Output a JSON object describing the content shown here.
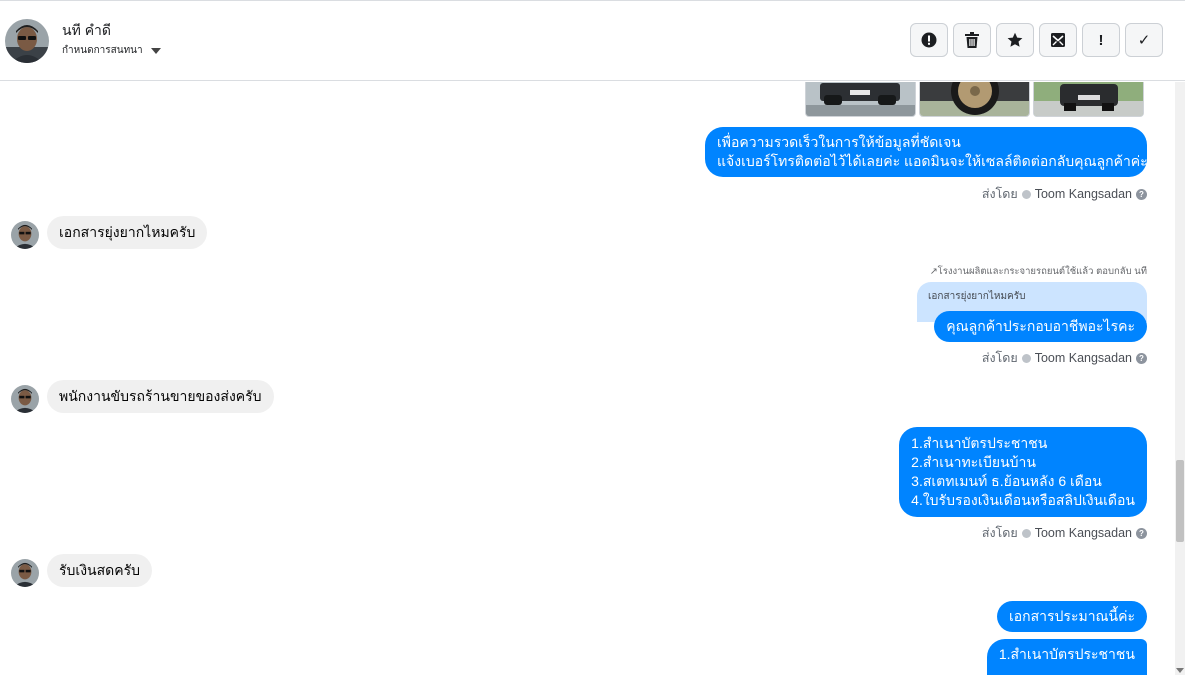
{
  "header": {
    "contact_name": "นที คำดี",
    "assign_label": "กำหนดการสนทนา",
    "toolbar": [
      {
        "name": "spam-button",
        "icon": "alert-circle-icon"
      },
      {
        "name": "delete-button",
        "icon": "trash-icon"
      },
      {
        "name": "star-button",
        "icon": "star-icon"
      },
      {
        "name": "mark-unread-button",
        "icon": "envelope-icon"
      },
      {
        "name": "follow-up-button",
        "icon": "exclamation-icon",
        "glyph": "!"
      },
      {
        "name": "done-button",
        "icon": "check-icon",
        "glyph": "✓"
      }
    ]
  },
  "messages": {
    "m1_out": {
      "lines": [
        "เพื่อความรวดเร็วในการให้ข้อมูลที่ชัดเจน",
        "แจ้งเบอร์โทรติดต่อไว้ได้เลยค่ะ แอดมินจะให้เซลล์ติดต่อกลับคุณลูกค้าค่ะ"
      ],
      "sent_by_label": "ส่งโดย",
      "sender": "Toom Kangsadan"
    },
    "m2_in": {
      "text": "เอกสารยุ่งยากไหมครับ"
    },
    "m3_out": {
      "reply_note": "โรงงานผลิตและกระจายรถยนต์ใช้แล้ว ตอบกลับ นที",
      "quote": "เอกสารยุ่งยากไหมครับ",
      "text": "คุณลูกค้าประกอบอาชีพอะไรคะ",
      "sent_by_label": "ส่งโดย",
      "sender": "Toom Kangsadan"
    },
    "m4_in": {
      "text": "พนักงานขับรถร้านขายของส่งครับ"
    },
    "m5_out": {
      "lines": [
        "1.สำเนาบัตรประชาชน",
        "2.สำเนาทะเบียนบ้าน",
        "3.สเตทเมนท์ ธ.ย้อนหลัง 6 เดือน",
        "4.ใบรับรองเงินเดือนหรือสลิปเงินเดือน"
      ],
      "sent_by_label": "ส่งโดย",
      "sender": "Toom Kangsadan"
    },
    "m6_in": {
      "text": "รับเงินสดครับ"
    },
    "m7_out": {
      "text": "เอกสารประมาณนี้ค่ะ"
    },
    "m8_out": {
      "lines": [
        "1.สำเนาบัตรประชาชน"
      ]
    }
  },
  "colors": {
    "outgoing_bubble": "#0084ff",
    "incoming_bubble": "#f0f0f0",
    "quote_bubble": "#cce4ff"
  }
}
